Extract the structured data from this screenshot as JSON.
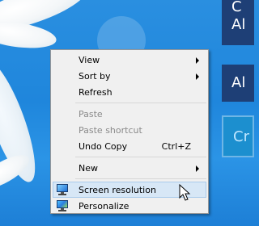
{
  "desktop": {
    "tiles": [
      {
        "lines": [
          "C",
          "Al"
        ]
      },
      {
        "lines": [
          "Al"
        ]
      },
      {
        "lines": [
          "Cr"
        ]
      }
    ]
  },
  "context_menu": {
    "items": [
      {
        "label": "View",
        "shortcut": "",
        "submenu": true,
        "disabled": false
      },
      {
        "label": "Sort by",
        "shortcut": "",
        "submenu": true,
        "disabled": false
      },
      {
        "label": "Refresh",
        "shortcut": "",
        "submenu": false,
        "disabled": false
      },
      {
        "label": "Paste",
        "shortcut": "",
        "submenu": false,
        "disabled": true
      },
      {
        "label": "Paste shortcut",
        "shortcut": "",
        "submenu": false,
        "disabled": true
      },
      {
        "label": "Undo Copy",
        "shortcut": "Ctrl+Z",
        "submenu": false,
        "disabled": false
      },
      {
        "label": "New",
        "shortcut": "",
        "submenu": true,
        "disabled": false
      },
      {
        "label": "Screen resolution",
        "shortcut": "",
        "submenu": false,
        "disabled": false,
        "highlighted": true,
        "icon": "monitor-icon"
      },
      {
        "label": "Personalize",
        "shortcut": "",
        "submenu": false,
        "disabled": false,
        "icon": "personalize-monitor-icon"
      }
    ]
  },
  "colors": {
    "desktop_blue": "#2a8fe0",
    "tile_navy": "#1e3f76",
    "menu_bg": "#f0f0f0",
    "highlight": "#d7e7f6"
  }
}
